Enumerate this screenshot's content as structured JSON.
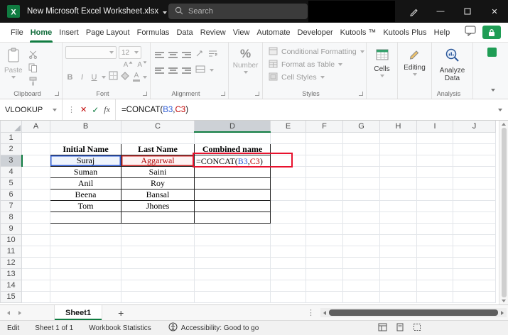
{
  "colors": {
    "excel_green": "#107c41",
    "ref_blue": "#2e5cd5",
    "ref_red": "#c00000",
    "annotation_red": "#e8112d"
  },
  "titlebar": {
    "title": "New Microsoft Excel Worksheet.xlsx",
    "search_placeholder": "Search"
  },
  "menu": {
    "active_tab": "Home",
    "tabs": [
      "File",
      "Home",
      "Insert",
      "Page Layout",
      "Formulas",
      "Data",
      "Review",
      "View",
      "Automate",
      "Developer",
      "Kutools ™",
      "Kutools Plus",
      "Help"
    ]
  },
  "ribbon": {
    "clipboard": {
      "paste_label": "Paste",
      "group_label": "Clipboard"
    },
    "font": {
      "bold": "B",
      "italic": "I",
      "underline": "U",
      "size_value": "12",
      "group_label": "Font"
    },
    "alignment": {
      "group_label": "Alignment"
    },
    "number": {
      "percent_glyph": "%",
      "button_label": "Number"
    },
    "styles": {
      "items": [
        "Conditional Formatting",
        "Format as Table",
        "Cell Styles"
      ],
      "group_label": "Styles"
    },
    "cells": {
      "button_label": "Cells"
    },
    "editing": {
      "button_label": "Editing"
    },
    "analysis": {
      "button_label_line1": "Analyze",
      "button_label_line2": "Data",
      "group_label": "Analysis"
    }
  },
  "formula_bar": {
    "name_box_value": "VLOOKUP",
    "fx_label": "fx",
    "formula_parts": [
      {
        "text": "=CONCAT(",
        "color": "#111111"
      },
      {
        "text": "B3",
        "color": "#2e5cd5"
      },
      {
        "text": ",",
        "color": "#111111"
      },
      {
        "text": "C3",
        "color": "#c00000"
      },
      {
        "text": ")",
        "color": "#111111"
      }
    ]
  },
  "grid": {
    "columns": [
      "A",
      "B",
      "C",
      "D",
      "E",
      "F",
      "G",
      "H",
      "I",
      "J"
    ],
    "rows": 15,
    "selected_column": "D",
    "selected_row": 3,
    "cells": {
      "B2": "Initial Name",
      "C2": "Last Name",
      "D2": "Combined name",
      "B3": "Suraj",
      "C3": "Aggarwal",
      "B4": "Suman",
      "C4": "Saini",
      "B5": "Anil",
      "C5": "Roy",
      "B6": "Beena",
      "C6": "Bansal",
      "B7": "Tom",
      "C7": "Jhones"
    }
  },
  "sheet_bar": {
    "active_tab": "Sheet1",
    "add_label": "+"
  },
  "status_bar": {
    "mode": "Edit",
    "sheet_info": "Sheet 1 of 1",
    "workbook_statistics": "Workbook Statistics",
    "accessibility": "Accessibility: Good to go"
  }
}
